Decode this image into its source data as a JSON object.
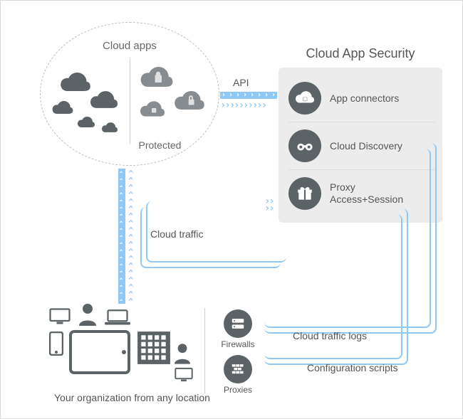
{
  "cloud_apps": {
    "title": "Cloud apps",
    "protected_label": "Protected"
  },
  "cas": {
    "title": "Cloud App Security",
    "rows": [
      {
        "label": "App connectors"
      },
      {
        "label": "Cloud Discovery"
      },
      {
        "label": "Proxy\nAccess+Session"
      }
    ]
  },
  "flows": {
    "api": "API",
    "cloud_traffic": "Cloud traffic",
    "cloud_traffic_logs": "Cloud traffic logs",
    "configuration_scripts": "Configuration scripts"
  },
  "infra": {
    "firewalls": "Firewalls",
    "proxies": "Proxies"
  },
  "org": {
    "label": "Your organization from any location"
  }
}
